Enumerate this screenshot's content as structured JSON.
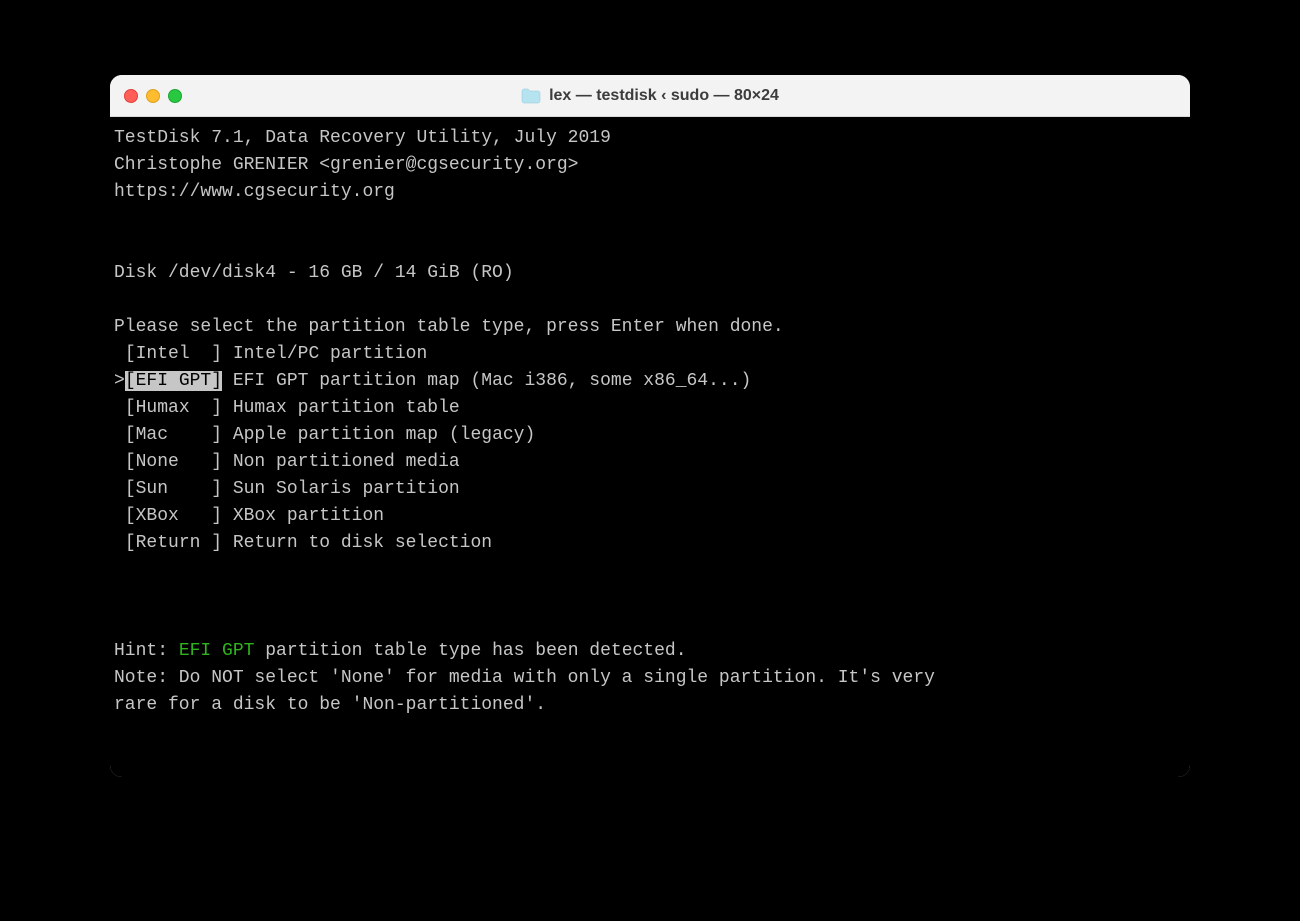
{
  "window": {
    "title": "lex — testdisk ‹ sudo — 80×24"
  },
  "header": {
    "line1": "TestDisk 7.1, Data Recovery Utility, July 2019",
    "line2": "Christophe GRENIER <grenier@cgsecurity.org>",
    "line3": "https://www.cgsecurity.org"
  },
  "disk_info": "Disk /dev/disk4 - 16 GB / 14 GiB (RO)",
  "prompt": "Please select the partition table type, press Enter when done.",
  "menu": [
    {
      "prefix": " ",
      "label": "[Intel  ]",
      "desc": " Intel/PC partition",
      "selected": false
    },
    {
      "prefix": ">",
      "label": "[EFI GPT]",
      "desc": " EFI GPT partition map (Mac i386, some x86_64...)",
      "selected": true
    },
    {
      "prefix": " ",
      "label": "[Humax  ]",
      "desc": " Humax partition table",
      "selected": false
    },
    {
      "prefix": " ",
      "label": "[Mac    ]",
      "desc": " Apple partition map (legacy)",
      "selected": false
    },
    {
      "prefix": " ",
      "label": "[None   ]",
      "desc": " Non partitioned media",
      "selected": false
    },
    {
      "prefix": " ",
      "label": "[Sun    ]",
      "desc": " Sun Solaris partition",
      "selected": false
    },
    {
      "prefix": " ",
      "label": "[XBox   ]",
      "desc": " XBox partition",
      "selected": false
    },
    {
      "prefix": " ",
      "label": "[Return ]",
      "desc": " Return to disk selection",
      "selected": false
    }
  ],
  "hint": {
    "prefix": "Hint: ",
    "highlight": "EFI GPT",
    "suffix": " partition table type has been detected."
  },
  "note_line1": "Note: Do NOT select 'None' for media with only a single partition. It's very",
  "note_line2": "rare for a disk to be 'Non-partitioned'."
}
